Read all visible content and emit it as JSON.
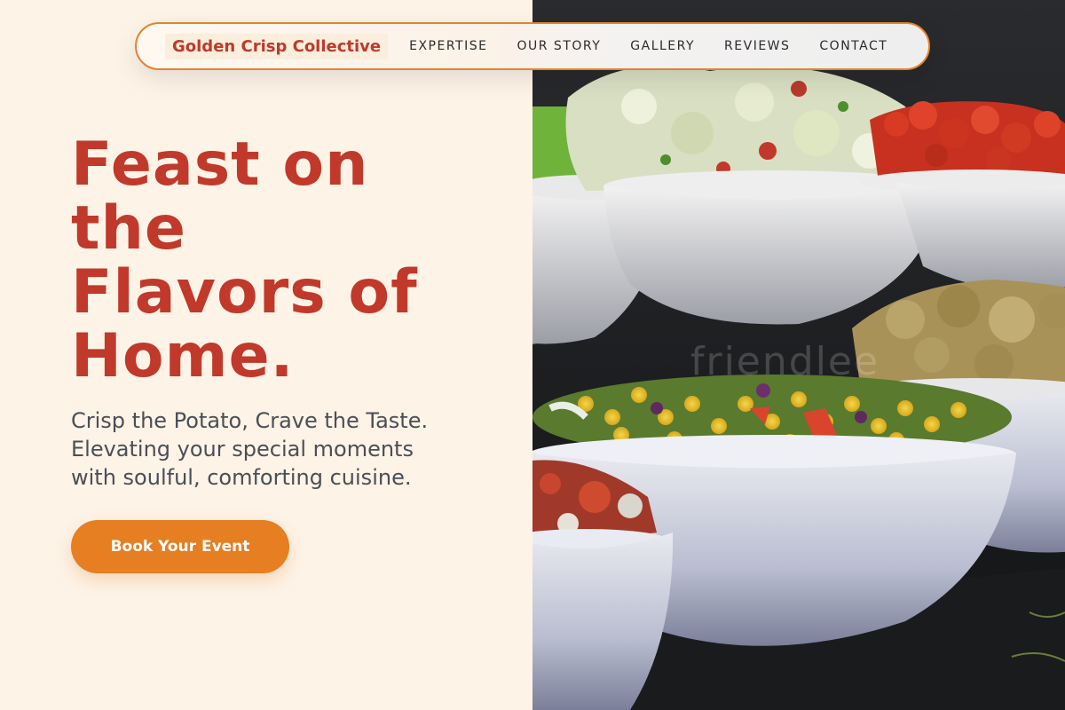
{
  "nav": {
    "brand": "Golden Crisp Collective",
    "links": [
      "EXPERTISE",
      "OUR STORY",
      "GALLERY",
      "REVIEWS",
      "CONTACT"
    ]
  },
  "hero": {
    "title_lines": [
      "Feast on",
      "the",
      "Flavors of",
      "Home."
    ],
    "subtitle_lines": [
      "Crisp the Potato, Crave the Taste.",
      "Elevating your special moments",
      "with soulful, comforting cuisine."
    ],
    "cta_label": "Book Your Event"
  },
  "image": {
    "description_icon": "salad-bowls-photo",
    "watermark": "friendlee"
  },
  "colors": {
    "accent": "#e67e22",
    "brand_red": "#c0392b",
    "background": "#fdf3e7",
    "text_gray": "#4a4f57"
  }
}
